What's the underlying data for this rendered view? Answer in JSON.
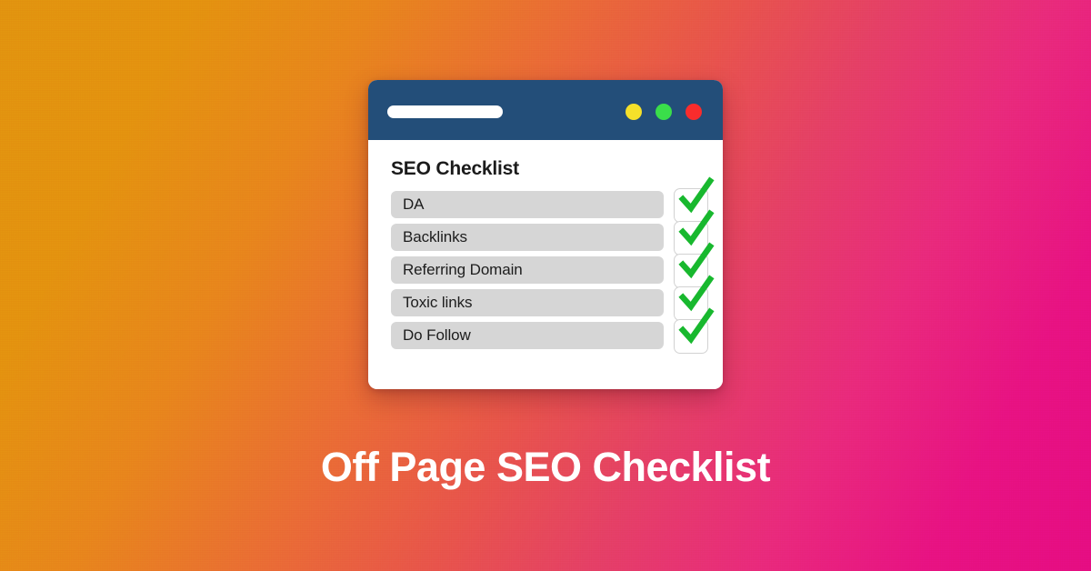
{
  "background": {
    "gradient_from": "#e2940f",
    "gradient_mid": "#e8544c",
    "gradient_to": "#e60d83"
  },
  "browser": {
    "title_bar_color": "#234e79",
    "address_bar_value": "",
    "window_controls": [
      {
        "name": "minimize-dot",
        "color": "#f5e02a"
      },
      {
        "name": "maximize-dot",
        "color": "#3ade4a"
      },
      {
        "name": "close-dot",
        "color": "#f92c2c"
      }
    ]
  },
  "card": {
    "title": "SEO Checklist",
    "items": [
      {
        "label": "DA",
        "checked": true
      },
      {
        "label": "Backlinks",
        "checked": true
      },
      {
        "label": "Referring Domain",
        "checked": true
      },
      {
        "label": "Toxic links",
        "checked": true
      },
      {
        "label": "Do Follow",
        "checked": true
      }
    ],
    "check_color": "#18b82e"
  },
  "headline": {
    "text": "Off Page SEO Checklist",
    "color": "#ffffff"
  }
}
